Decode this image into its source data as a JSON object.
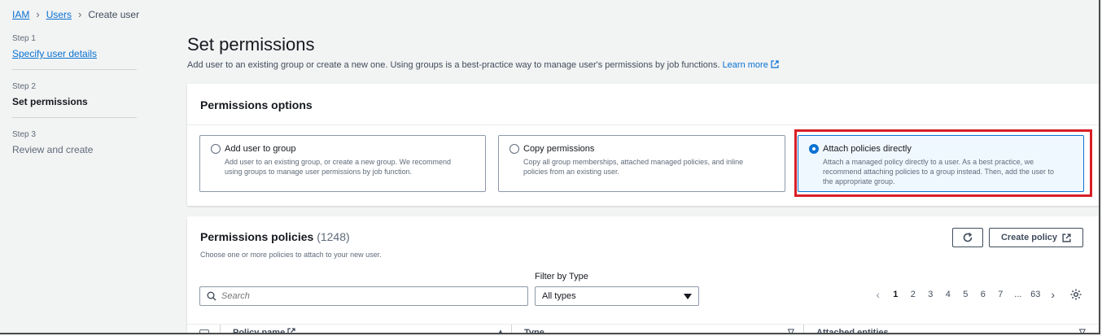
{
  "breadcrumb": {
    "iam": "IAM",
    "users": "Users",
    "current": "Create user"
  },
  "steps": [
    {
      "num": "Step 1",
      "title": "Specify user details"
    },
    {
      "num": "Step 2",
      "title": "Set permissions"
    },
    {
      "num": "Step 3",
      "title": "Review and create"
    }
  ],
  "header": {
    "title": "Set permissions",
    "description": "Add user to an existing group or create a new one. Using groups is a best-practice way to manage user's permissions by job functions.",
    "learn_more": "Learn more"
  },
  "options": {
    "heading": "Permissions options",
    "items": [
      {
        "title": "Add user to group",
        "desc_line1": "Add user to an existing group, or create a new group. We recommend",
        "desc_line2": "using groups to manage user permissions by job function.",
        "desc_line3": ""
      },
      {
        "title": "Copy permissions",
        "desc_line1": "Copy all group memberships, attached managed policies, and inline",
        "desc_line2": "policies from an existing user.",
        "desc_line3": ""
      },
      {
        "title": "Attach policies directly",
        "desc_line1": "Attach a managed policy directly to a user. As a best practice, we",
        "desc_line2": "recommend attaching policies to a group instead. Then, add the user to",
        "desc_line3": "the appropriate group."
      }
    ],
    "selected": "Attach policies directly"
  },
  "policies": {
    "title": "Permissions policies",
    "count": "(1248)",
    "subtitle": "Choose one or more policies to attach to your new user.",
    "create_button": "Create policy",
    "filter_label": "Filter by Type",
    "search_placeholder": "Search",
    "type_selected": "All types",
    "pages": [
      "1",
      "2",
      "3",
      "4",
      "5",
      "6",
      "7",
      "...",
      "63"
    ],
    "current_page": "1",
    "columns": {
      "name": "Policy name",
      "type": "Type",
      "attached": "Attached entities"
    }
  },
  "colors": {
    "link": "#0972d3",
    "highlight": "#d91f26",
    "selected_bg": "#f0f8ff"
  },
  "icons": [
    "chevron-right-icon",
    "external-link-icon",
    "refresh-icon",
    "search-icon",
    "caret-down-icon",
    "settings-gear-icon",
    "sort-icon"
  ]
}
